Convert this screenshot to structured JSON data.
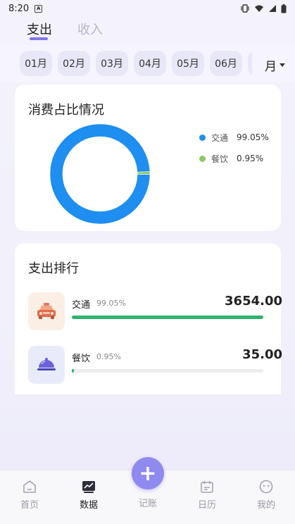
{
  "status_bar": {
    "time": "8:20",
    "notification_icon": "A"
  },
  "top_tabs": [
    {
      "label": "支出",
      "active": true
    },
    {
      "label": "收入",
      "active": false
    }
  ],
  "months": [
    "01月",
    "02月",
    "03月",
    "04月",
    "05月",
    "06月"
  ],
  "period_selector": "月",
  "pie_card": {
    "title": "消费占比情况",
    "legend": [
      {
        "name": "交通",
        "percent": "99.05%",
        "color": "#1e8ef0"
      },
      {
        "name": "餐饮",
        "percent": "0.95%",
        "color": "#8dc86a"
      }
    ]
  },
  "chart_data": {
    "type": "pie",
    "title": "消费占比情况",
    "categories": [
      "交通",
      "餐饮"
    ],
    "values": [
      99.05,
      0.95
    ],
    "colors": [
      "#1e8ef0",
      "#8dc86a"
    ],
    "legend_position": "right"
  },
  "rank_card": {
    "title": "支出排行",
    "items": [
      {
        "name": "交通",
        "percent": "99.05%",
        "amount": "3654.00",
        "ratio": 1.0,
        "icon": "taxi-icon"
      },
      {
        "name": "餐饮",
        "percent": "0.95%",
        "amount": "35.00",
        "ratio": 0.0096,
        "icon": "food-cloche-icon"
      }
    ]
  },
  "bottom_nav": [
    {
      "label": "首页",
      "icon": "home-icon",
      "active": false
    },
    {
      "label": "数据",
      "icon": "chart-icon",
      "active": true
    },
    {
      "label": "记账",
      "icon": "plus-icon",
      "active": false
    },
    {
      "label": "日历",
      "icon": "calendar-icon",
      "active": false
    },
    {
      "label": "我的",
      "icon": "profile-icon",
      "active": false
    }
  ],
  "fab_label": "+"
}
